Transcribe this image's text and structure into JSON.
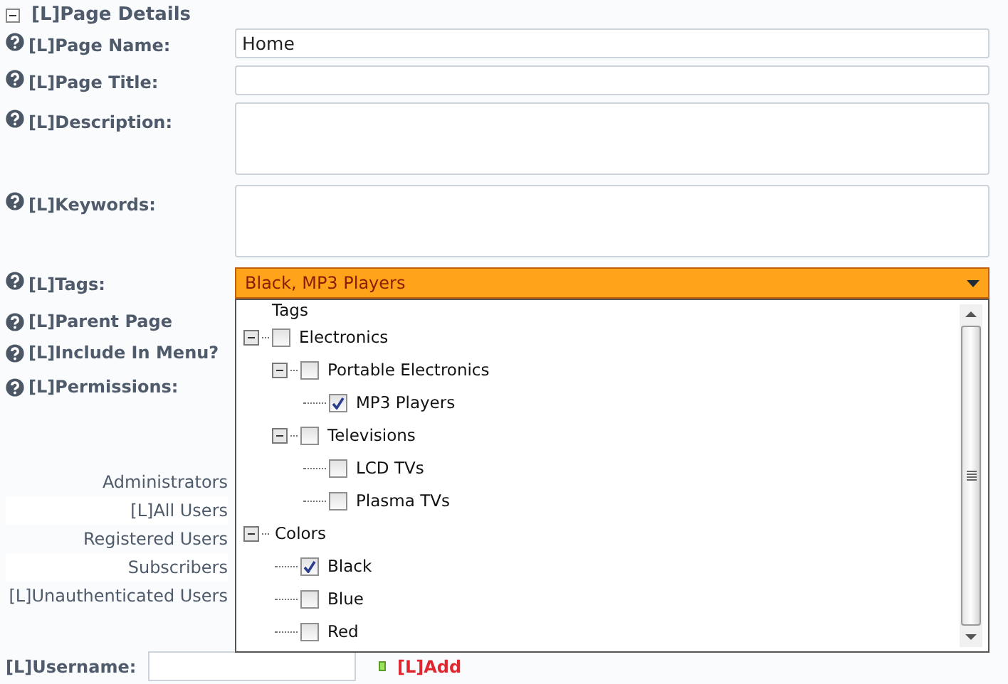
{
  "section": {
    "title": "[L]Page Details",
    "expanded": true
  },
  "fields": [
    {
      "label": "[L]Page Name:",
      "kind": "text",
      "value": "Home"
    },
    {
      "label": "[L]Page Title:",
      "kind": "text"
    },
    {
      "label": "[L]Description:",
      "kind": "textarea"
    },
    {
      "label": "[L]Keywords:",
      "kind": "textarea"
    },
    {
      "label": "[L]Tags:",
      "kind": "dropdown",
      "value": "Black, MP3 Players",
      "expanded": true
    },
    {
      "label": "[L]Parent Page",
      "kind": "covered"
    },
    {
      "label": "[L]Include In Menu?",
      "kind": "covered"
    },
    {
      "label": "[L]Permissions:",
      "kind": "covered"
    }
  ],
  "roles": [
    "Administrators",
    "[L]All Users",
    "Registered Users",
    "Subscribers",
    "[L]Unauthenticated Users"
  ],
  "username": {
    "label": "[L]Username:"
  },
  "add_link": "[L]Add",
  "tags_tree": {
    "root": "Tags",
    "items": [
      {
        "label": "Electronics",
        "checked": false,
        "expanded": true,
        "children": [
          {
            "label": "Portable Electronics",
            "checked": false,
            "expanded": true,
            "children": [
              {
                "label": "MP3 Players",
                "checked": true
              }
            ]
          },
          {
            "label": "Televisions",
            "checked": false,
            "expanded": true,
            "children": [
              {
                "label": "LCD TVs",
                "checked": false
              },
              {
                "label": "Plasma TVs",
                "checked": false
              }
            ]
          }
        ]
      },
      {
        "label": "Colors",
        "expanded": true,
        "children": [
          {
            "label": "Black",
            "checked": true
          },
          {
            "label": "Blue",
            "checked": false
          },
          {
            "label": "Red",
            "checked": false
          }
        ]
      }
    ]
  }
}
